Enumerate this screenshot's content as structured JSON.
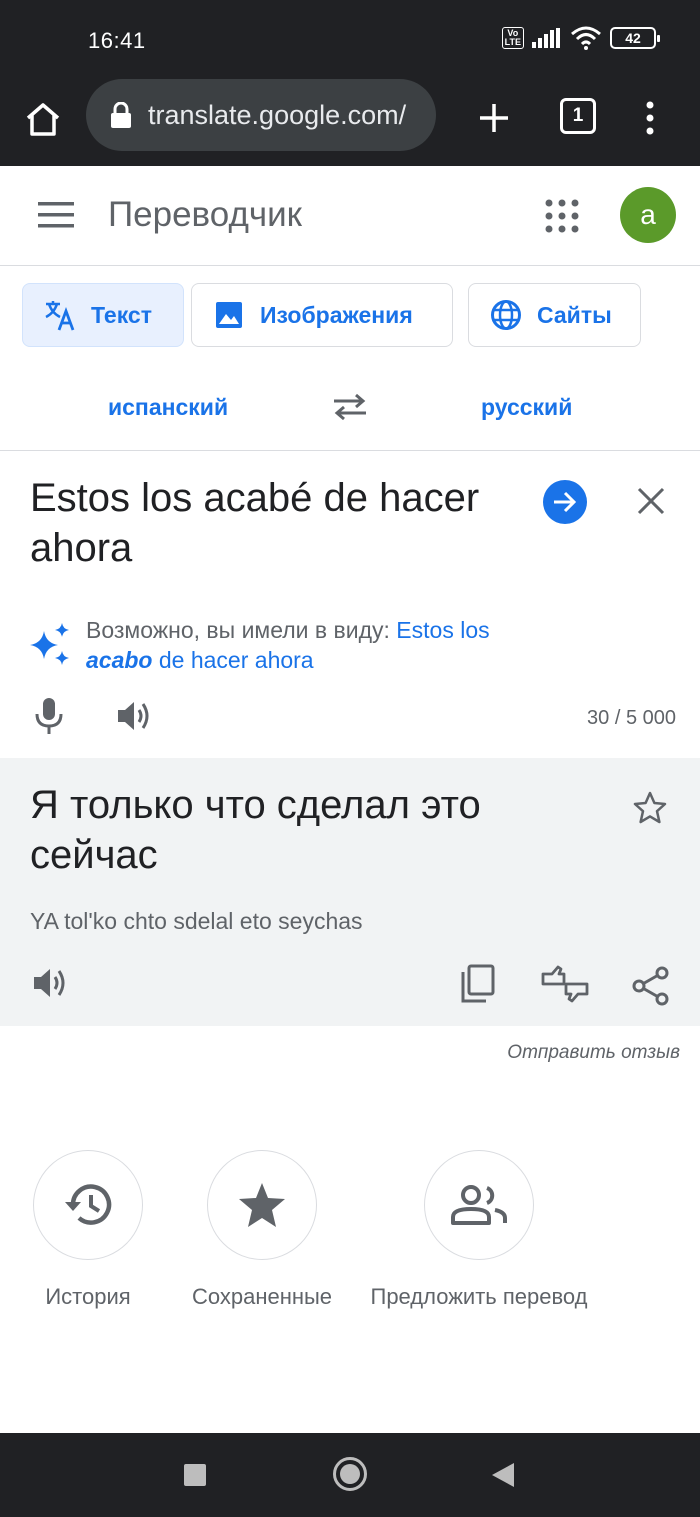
{
  "status_bar": {
    "time": "16:41",
    "volte_label": "Vo LTE",
    "battery": "42"
  },
  "browser": {
    "url": "translate.google.com/",
    "tab_count": "1"
  },
  "app": {
    "title": "Переводчик",
    "avatar_letter": "a",
    "accent_color": "#1a73e8"
  },
  "modes": [
    {
      "label": "Текст",
      "icon": "translate-icon",
      "active": true
    },
    {
      "label": "Изображения",
      "icon": "image-icon",
      "active": false
    },
    {
      "label": "Сайты",
      "icon": "globe-icon",
      "active": false
    }
  ],
  "languages": {
    "source": "испанский",
    "target": "русский"
  },
  "source": {
    "text": "Estos los acabé de hacer ahora",
    "suggestion_prefix": "Возможно, вы имели в виду:",
    "suggestion_part1": "Estos los",
    "suggestion_emph": "acabo",
    "suggestion_part2": "de hacer ahora",
    "char_count": "30 / 5 000"
  },
  "result": {
    "text": "Я только что сделал это сейчас",
    "transliteration": "YA tol'ko chto sdelal eto seychas"
  },
  "feedback_label": "Отправить отзыв",
  "shortcuts": [
    {
      "label": "История",
      "icon": "history-icon"
    },
    {
      "label": "Сохраненные",
      "icon": "star-icon"
    },
    {
      "label": "Предложить перевод",
      "icon": "people-icon"
    }
  ]
}
